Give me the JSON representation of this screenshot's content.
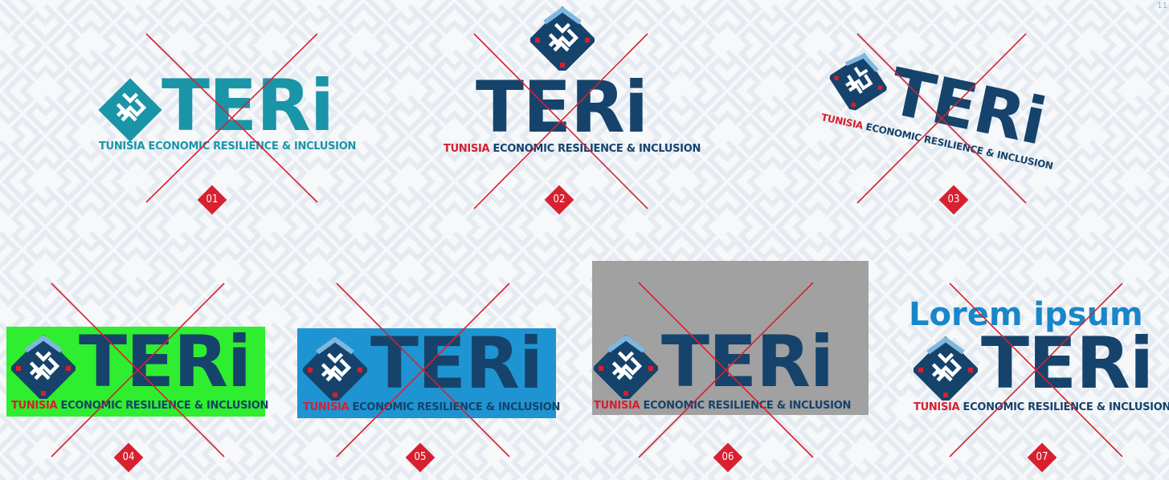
{
  "page_number": "11",
  "brand": {
    "wordmark": "TERi",
    "tagline_red": "TUNISIA",
    "tagline_rest": " ECONOMIC RESILIENCE & INCLUSION"
  },
  "colors": {
    "navy": "#15436b",
    "teal": "#1a95a8",
    "red": "#d61f2f",
    "green_bg": "#2fee2f",
    "blue_bg": "#1f94d2",
    "gray_bg": "#a1a1a1"
  },
  "variants": [
    {
      "number": "01",
      "issue": "teal-recolor"
    },
    {
      "number": "02",
      "issue": "stacked-layout"
    },
    {
      "number": "03",
      "issue": "rotated"
    },
    {
      "number": "04",
      "issue": "green-background"
    },
    {
      "number": "05",
      "issue": "blue-background"
    },
    {
      "number": "06",
      "issue": "gray-background"
    },
    {
      "number": "07",
      "issue": "added-text",
      "extra_text": "Lorem ipsum"
    }
  ]
}
